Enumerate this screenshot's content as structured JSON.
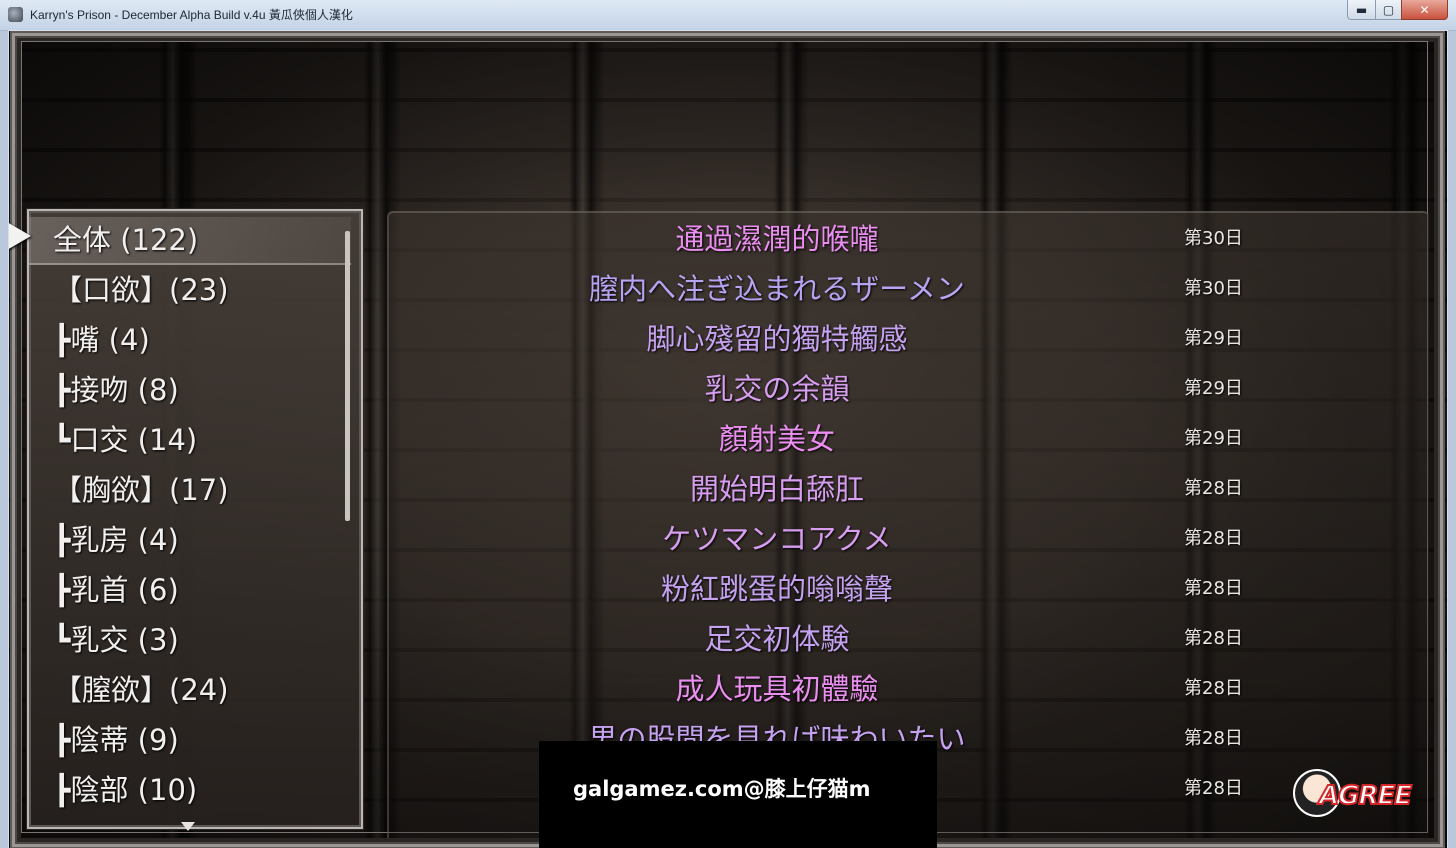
{
  "window": {
    "title": "Karryn's Prison - December Alpha Build v.4u 黃瓜俠個人漢化",
    "min_glyph": "▬",
    "max_glyph": "▢",
    "close_glyph": "✕"
  },
  "categories": {
    "items": [
      {
        "label": "全体 (122)",
        "selected": true
      },
      {
        "label": "【口欲】(23)",
        "selected": false
      },
      {
        "label": "┣嘴 (4)",
        "selected": false
      },
      {
        "label": "┣接吻 (8)",
        "selected": false
      },
      {
        "label": "┗口交 (14)",
        "selected": false
      },
      {
        "label": "【胸欲】(17)",
        "selected": false
      },
      {
        "label": "┣乳房 (4)",
        "selected": false
      },
      {
        "label": "┣乳首 (6)",
        "selected": false
      },
      {
        "label": "┗乳交 (3)",
        "selected": false
      },
      {
        "label": "【膣欲】(24)",
        "selected": false
      },
      {
        "label": "┣陰蒂 (9)",
        "selected": false
      },
      {
        "label": "┣陰部 (10)",
        "selected": false
      }
    ]
  },
  "records": [
    {
      "title": "通過濕潤的喉嚨",
      "day": "第30日",
      "color": "#ea8ef0"
    },
    {
      "title": "膣内へ注ぎ込まれるザーメン",
      "day": "第30日",
      "color": "#b6a3f2"
    },
    {
      "title": "脚心殘留的獨特觸感",
      "day": "第29日",
      "color": "#c5a2f0"
    },
    {
      "title": "乳交の余韻",
      "day": "第29日",
      "color": "#d79ef0"
    },
    {
      "title": "顏射美女",
      "day": "第29日",
      "color": "#ea8ef0"
    },
    {
      "title": "開始明白舔肛",
      "day": "第28日",
      "color": "#d79ef0"
    },
    {
      "title": "ケツマンコアクメ",
      "day": "第28日",
      "color": "#d79ef0"
    },
    {
      "title": "粉紅跳蛋的嗡嗡聲",
      "day": "第28日",
      "color": "#c5a2f0"
    },
    {
      "title": "足交初体験",
      "day": "第28日",
      "color": "#c5a2f0"
    },
    {
      "title": "成人玩具初體驗",
      "day": "第28日",
      "color": "#ea8ef0"
    },
    {
      "title": "男の股間を見れば味わいたい",
      "day": "第28日",
      "color": "#c5a2f0"
    },
    {
      "title": "",
      "day": "第28日",
      "color": "#c5a2f0"
    }
  ],
  "watermark": {
    "text": "galgamez.com@膝上仔猫m",
    "logo_text": "AGREE"
  }
}
